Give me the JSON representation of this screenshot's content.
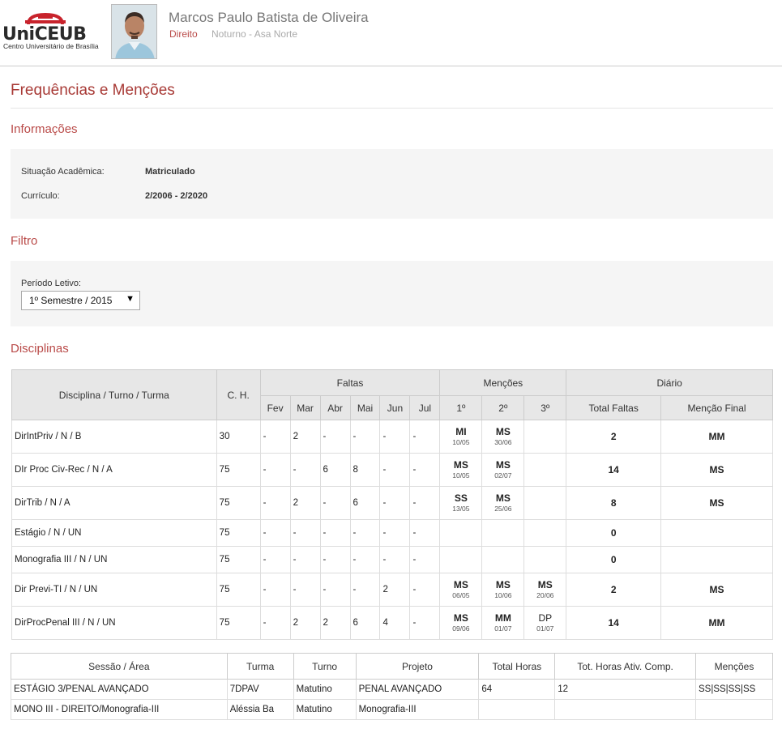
{
  "header": {
    "logo_text": "UniCEUB",
    "logo_subtitle": "Centro Universitário de Brasília",
    "student_name": "Marcos Paulo Batista de Oliveira",
    "course": "Direito",
    "shift_campus": "Noturno - Asa Norte"
  },
  "page_title": "Frequências e Menções",
  "informacoes": {
    "heading": "Informações",
    "situacao_label": "Situação Acadêmica:",
    "situacao_value": "Matriculado",
    "curriculo_label": "Currículo:",
    "curriculo_value": "2/2006 - 2/2020"
  },
  "filtro": {
    "heading": "Filtro",
    "periodo_label": "Período Letivo:",
    "periodo_value": "1º Semestre / 2015"
  },
  "disciplinas": {
    "heading": "Disciplinas",
    "headers": {
      "disciplina": "Disciplina / Turno / Turma",
      "ch": "C. H.",
      "faltas": "Faltas",
      "mencoes": "Menções",
      "diario": "Diário",
      "months": [
        "Fev",
        "Mar",
        "Abr",
        "Mai",
        "Jun",
        "Jul"
      ],
      "mencao_cols": [
        "1º",
        "2º",
        "3º"
      ],
      "total_faltas": "Total Faltas",
      "mencao_final": "Menção Final"
    },
    "rows": [
      {
        "name": "DirIntPriv / N / B",
        "ch": "30",
        "faltas": [
          "-",
          "2",
          "-",
          "-",
          "-",
          "-"
        ],
        "m1": "MI",
        "m1d": "10/05",
        "m2": "MS",
        "m2d": "30/06",
        "m3": "",
        "m3d": "",
        "total": "2",
        "final": "MM"
      },
      {
        "name": "DIr Proc Civ-Rec / N / A",
        "ch": "75",
        "faltas": [
          "-",
          "-",
          "6",
          "8",
          "-",
          "-"
        ],
        "m1": "MS",
        "m1d": "10/05",
        "m2": "MS",
        "m2d": "02/07",
        "m3": "",
        "m3d": "",
        "total": "14",
        "final": "MS"
      },
      {
        "name": "DirTrib / N / A",
        "ch": "75",
        "faltas": [
          "-",
          "2",
          "-",
          "6",
          "-",
          "-"
        ],
        "m1": "SS",
        "m1d": "13/05",
        "m2": "MS",
        "m2d": "25/06",
        "m3": "",
        "m3d": "",
        "total": "8",
        "final": "MS"
      },
      {
        "name": "Estágio / N / UN",
        "ch": "75",
        "faltas": [
          "-",
          "-",
          "-",
          "-",
          "-",
          "-"
        ],
        "m1": "",
        "m1d": "",
        "m2": "",
        "m2d": "",
        "m3": "",
        "m3d": "",
        "total": "0",
        "final": ""
      },
      {
        "name": "Monografia III / N / UN",
        "ch": "75",
        "faltas": [
          "-",
          "-",
          "-",
          "-",
          "-",
          "-"
        ],
        "m1": "",
        "m1d": "",
        "m2": "",
        "m2d": "",
        "m3": "",
        "m3d": "",
        "total": "0",
        "final": ""
      },
      {
        "name": "Dir Previ-TI / N / UN",
        "ch": "75",
        "faltas": [
          "-",
          "-",
          "-",
          "-",
          "2",
          "-"
        ],
        "m1": "MS",
        "m1d": "06/05",
        "m2": "MS",
        "m2d": "10/06",
        "m3": "MS",
        "m3d": "20/06",
        "total": "2",
        "final": "MS"
      },
      {
        "name": "DirProcPenal III / N / UN",
        "ch": "75",
        "faltas": [
          "-",
          "2",
          "2",
          "6",
          "4",
          "-"
        ],
        "m1": "MS",
        "m1d": "09/06",
        "m2": "MM",
        "m2d": "01/07",
        "m3": "DP",
        "m3d": "01/07",
        "total": "14",
        "final": "MM"
      }
    ]
  },
  "sessoes": {
    "headers": [
      "Sessão / Área",
      "Turma",
      "Turno",
      "Projeto",
      "Total Horas",
      "Tot. Horas Ativ. Comp.",
      "Menções"
    ],
    "rows": [
      [
        "ESTÁGIO 3/PENAL AVANÇADO",
        "7DPAV",
        "Matutino",
        "PENAL AVANÇADO",
        "64",
        "12",
        "SS|SS|SS|SS"
      ],
      [
        "MONO III - DIREITO/Monografia-III",
        "Aléssia Ba",
        "Matutino",
        "Monografia-III",
        "",
        "",
        ""
      ]
    ]
  }
}
